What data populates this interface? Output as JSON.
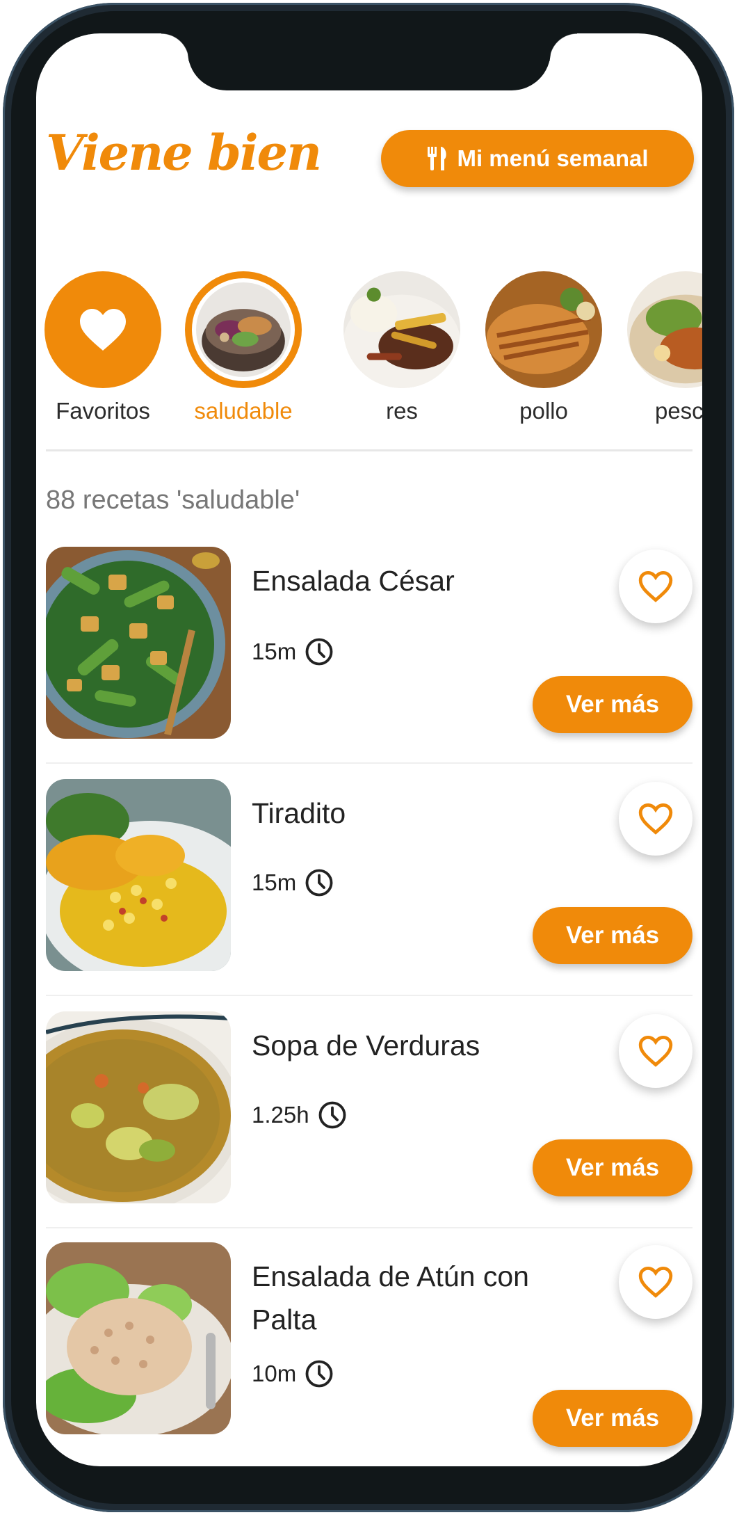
{
  "app": {
    "logo_text": "Viene bien",
    "brand_color": "#F08A0A"
  },
  "header": {
    "menu_button_label": "Mi menú semanal",
    "menu_button_icon": "fork-knife-icon"
  },
  "categories": [
    {
      "label": "Favoritos",
      "icon": "heart-icon",
      "active": false
    },
    {
      "label": "saludable",
      "active": true
    },
    {
      "label": "res",
      "active": false
    },
    {
      "label": "pollo",
      "active": false
    },
    {
      "label": "pesca",
      "active": false
    }
  ],
  "results": {
    "count_text": "88 recetas 'saludable'"
  },
  "recipes": [
    {
      "title": "Ensalada César",
      "time": "15m",
      "button": "Ver más",
      "favorite_icon": "heart-outline-icon"
    },
    {
      "title": "Tiradito",
      "time": "15m",
      "button": "Ver más",
      "favorite_icon": "heart-outline-icon"
    },
    {
      "title": "Sopa de Verduras",
      "time": "1.25h",
      "button": "Ver más",
      "favorite_icon": "heart-outline-icon"
    },
    {
      "title": "Ensalada de Atún con Palta",
      "time": "10m",
      "button": "Ver más",
      "favorite_icon": "heart-outline-icon"
    }
  ]
}
